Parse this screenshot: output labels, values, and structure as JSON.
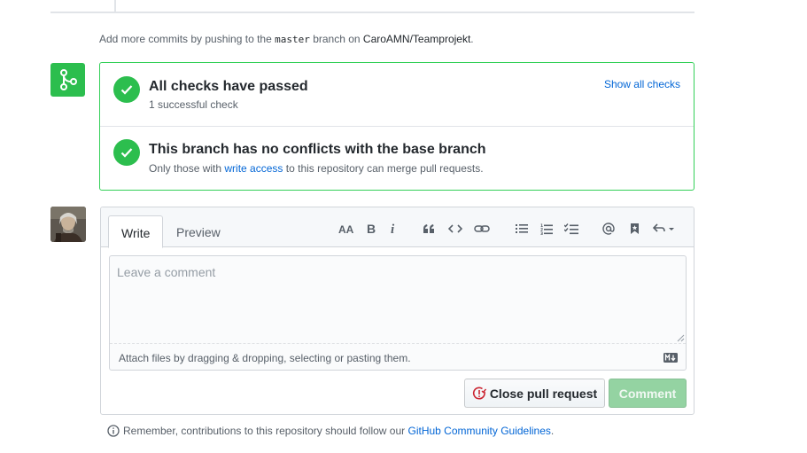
{
  "push_hint": {
    "prefix": "Add more commits by pushing to the",
    "branch": "master",
    "middle": "branch on",
    "repo": "CaroAMN/Teamprojekt",
    "suffix": "."
  },
  "merge_box": {
    "checks": {
      "title": "All checks have passed",
      "subtitle": "1 successful check",
      "show_all": "Show all checks"
    },
    "conflicts": {
      "title": "This branch has no conflicts with the base branch",
      "sub_prefix": "Only those with",
      "sub_link": "write access",
      "sub_suffix": "to this repository can merge pull requests."
    }
  },
  "comment_form": {
    "tabs": [
      {
        "label": "Write"
      },
      {
        "label": "Preview"
      }
    ],
    "toolbar_icons": [
      "text-size-icon",
      "bold-icon",
      "italic-icon",
      "quote-icon",
      "code-icon",
      "link-icon",
      "unordered-list-icon",
      "ordered-list-icon",
      "task-list-icon",
      "mention-icon",
      "bookmark-icon",
      "reply-icon"
    ],
    "placeholder": "Leave a comment",
    "attach_text": "Attach files by dragging & dropping, selecting or pasting them.",
    "close_label": "Close pull request",
    "comment_label": "Comment"
  },
  "guidelines": {
    "prefix": "Remember, contributions to this repository should follow our",
    "link": "GitHub Community Guidelines",
    "suffix": "."
  },
  "colors": {
    "success": "#2cbe4e",
    "link": "#0366d6",
    "border": "#d1d5da",
    "comment_disabled": "#94d3a2"
  }
}
